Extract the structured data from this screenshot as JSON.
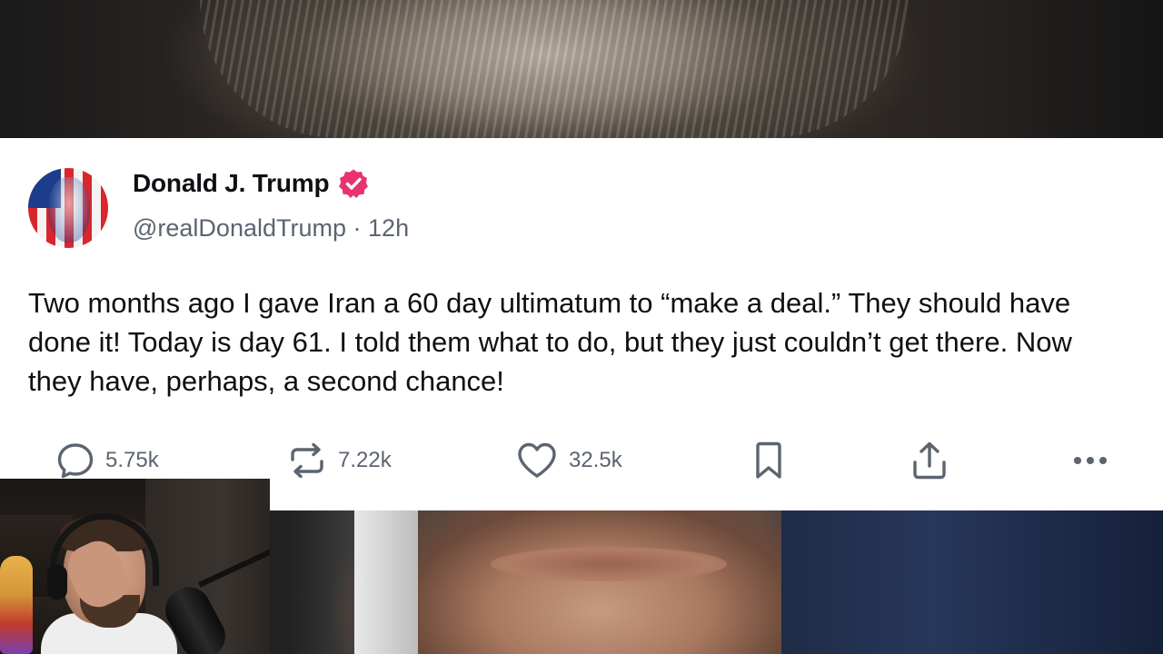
{
  "post": {
    "author_name": "Donald J. Trump",
    "handle": "@realDonaldTrump",
    "separator": "·",
    "time": "12h",
    "verified": true,
    "text": "Two months ago I gave Iran a 60 day ultimatum to “make a deal.” They should have done it! Today is day 61. I told them what to do, but they just couldn’t get there. Now they have, perhaps, a second chance!"
  },
  "actions": {
    "replies": {
      "icon": "comment-icon",
      "count": "5.75k"
    },
    "reposts": {
      "icon": "repost-icon",
      "count": "7.22k"
    },
    "likes": {
      "icon": "heart-icon",
      "count": "32.5k"
    },
    "bookmark": {
      "icon": "bookmark-icon"
    },
    "share": {
      "icon": "share-icon"
    },
    "more": {
      "icon": "more-icon"
    }
  },
  "colors": {
    "card_background": "#ffffff",
    "text_primary": "#0f0f14",
    "text_secondary": "#5b6470",
    "verified_badge": "#e8336f"
  }
}
